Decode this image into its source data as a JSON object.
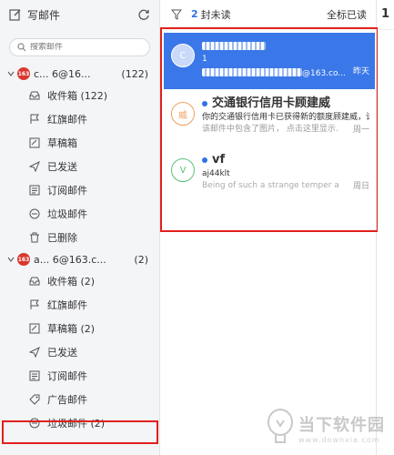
{
  "sidebar": {
    "compose_label": "写邮件",
    "search_placeholder": "搜索邮件",
    "accounts": [
      {
        "logo": "163",
        "address": "c... 6@16...",
        "count": "(122)",
        "folders": [
          {
            "icon": "inbox-icon",
            "label": "收件箱 (122)"
          },
          {
            "icon": "flag-icon",
            "label": "红旗邮件"
          },
          {
            "icon": "draft-icon",
            "label": "草稿箱"
          },
          {
            "icon": "send-icon",
            "label": "已发送"
          },
          {
            "icon": "subscription-icon",
            "label": "订阅邮件"
          },
          {
            "icon": "spam-icon",
            "label": "垃圾邮件"
          },
          {
            "icon": "trash-icon",
            "label": "已删除"
          }
        ]
      },
      {
        "logo": "163",
        "address": "a... 6@163.c...",
        "count": "(2)",
        "folders": [
          {
            "icon": "inbox-icon",
            "label": "收件箱 (2)"
          },
          {
            "icon": "flag-icon",
            "label": "红旗邮件"
          },
          {
            "icon": "draft-icon",
            "label": "草稿箱 (2)"
          },
          {
            "icon": "send-icon",
            "label": "已发送"
          },
          {
            "icon": "subscription-icon",
            "label": "订阅邮件"
          },
          {
            "icon": "ad-tag-icon",
            "label": "广告邮件"
          },
          {
            "icon": "spam-icon",
            "label": "垃圾邮件 (2)"
          }
        ]
      }
    ]
  },
  "list_header": {
    "unread_count": "2",
    "unread_label": "封未读",
    "mark_all_label": "全标已读"
  },
  "mails": [
    {
      "avatar": "C",
      "sender": "",
      "subject": "1",
      "preview": "@163.co...",
      "date": "昨天",
      "selected": true,
      "unread": false
    },
    {
      "avatar": "威",
      "sender": "交通银行信用卡顾建威",
      "subject": "你的交通银行信用卡已获得新的额度顾建威，请...",
      "preview": "该邮件中包含了图片， 点击这里显示...",
      "date": "周一",
      "selected": false,
      "unread": true
    },
    {
      "avatar": "V",
      "sender": "vf",
      "subject": "aj44klt",
      "preview": "Being of such a strange temper a...",
      "date": "周日",
      "selected": false,
      "unread": true
    }
  ],
  "right_panel": {
    "char": "1"
  },
  "watermark": {
    "title": "当下软件园",
    "url": "www.downxia.com"
  },
  "colors": {
    "accent": "#3a77e8",
    "highlight_border": "#e2201c"
  }
}
